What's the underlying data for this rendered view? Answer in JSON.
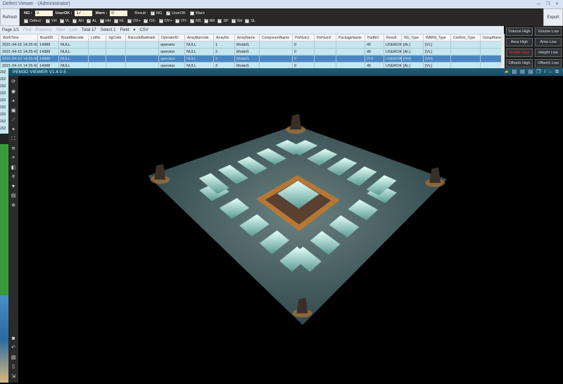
{
  "window": {
    "title": "Defect Viewer - (Administrator)"
  },
  "toolbar": {
    "refresh": "Refresh",
    "export": "Export",
    "ng_label": "NG :",
    "ng_value": "0",
    "userok_label": "UserOK :",
    "userok_value": "17",
    "warn_label": "Warn :",
    "warn_value": "0",
    "result_label": "Result :",
    "result_opts": [
      {
        "label": "NG",
        "checked": true
      },
      {
        "label": "UserOK",
        "checked": true
      },
      {
        "label": "Warn",
        "checked": false
      }
    ],
    "defect_label": "Defect :",
    "defect_opts": [
      "VH",
      "VL",
      "AH",
      "AL",
      "HH",
      "HL",
      "OX+",
      "OX-",
      "OY+",
      "OY-",
      "NS",
      "BR",
      "SP",
      "SH",
      "SL"
    ]
  },
  "pager": {
    "page": "Page 1/1",
    "first": "First",
    "previous": "Previous",
    "next": "Next",
    "last": "Last",
    "total": "Total 17",
    "select": "Select 1",
    "field": "Field",
    "csv": "CSV"
  },
  "table": {
    "columns": [
      "WorkTime",
      "BoardID",
      "BoardBarcode",
      "LotNo",
      "JigCode",
      "BarcodeBadmark",
      "OperatorID",
      "ArrayBarcode",
      "ArrayNo",
      "ArrayName",
      "ComponentName",
      "PinNum1",
      "PinNum2",
      "PackageName",
      "PadNO",
      "Result",
      "NG_Type",
      "WARN_Type",
      "Confirm_Type",
      "GroupName"
    ],
    "rows": [
      [
        "2021-04-15 14:25:43",
        "14988",
        "NULL",
        "",
        "",
        "",
        "operator",
        "NULL",
        "1",
        "Model1",
        "",
        "0",
        "",
        "",
        "45",
        "USEROK",
        "[AL]",
        "[VL]",
        "",
        ""
      ],
      [
        "2021-04-15 14:25:43",
        "14988",
        "NULL",
        "",
        "",
        "",
        "operator",
        "NULL",
        "2",
        "Model1",
        "",
        "0",
        "",
        "",
        "45",
        "USEROK",
        "[AL]",
        "[VL]",
        "",
        ""
      ],
      [
        "2021-04-15 14:25:43",
        "14988",
        "NULL",
        "",
        "",
        "",
        "operator",
        "NULL",
        "2",
        "Model1",
        "",
        "0",
        "",
        "",
        "213",
        "USEROK",
        "[HH]",
        "[VH]",
        "",
        ""
      ],
      [
        "2021-04-15 14:25:43",
        "14988",
        "NULL",
        "",
        "",
        "",
        "operator",
        "NULL",
        "3",
        "Model1",
        "",
        "0",
        "",
        "",
        "45",
        "USEROK",
        "[AL]",
        "[VL]",
        "",
        ""
      ]
    ],
    "selected_row": 2
  },
  "filters": [
    {
      "label": "Volume High"
    },
    {
      "label": "Volume Low"
    },
    {
      "label": "Area High"
    },
    {
      "label": "Area Low"
    },
    {
      "label": "Height High",
      "active": true
    },
    {
      "label": "Height Low"
    },
    {
      "label": "OffsetX High"
    },
    {
      "label": "OffsetX Low"
    }
  ],
  "viewer": {
    "title": "PEM3D VIEWER V1.4.0.5",
    "top_icons": [
      "folder-icon",
      "file-icon",
      "file-icon",
      "file-icon",
      "copy-icon",
      "info-icon",
      "minimize-icon",
      "restore-icon"
    ],
    "tools": [
      "rotate-icon",
      "eye-icon",
      "palette-icon",
      "image-icon",
      "ruler-icon",
      "pin-icon",
      "fit-icon",
      "layers-icon",
      "crop-icon",
      "split-icon",
      "number-icon",
      "filter-icon",
      "note-icon",
      "settings-icon"
    ],
    "bottom_tools": [
      "camera-icon",
      "undo-icon",
      "snapshot-icon",
      "save-icon",
      "export-icon"
    ],
    "colors": {
      "surface": "#3e5a5c",
      "pad": "#b8e8e0",
      "glow": "#c07830"
    }
  },
  "left_strip": {
    "row_prefix": "202"
  }
}
